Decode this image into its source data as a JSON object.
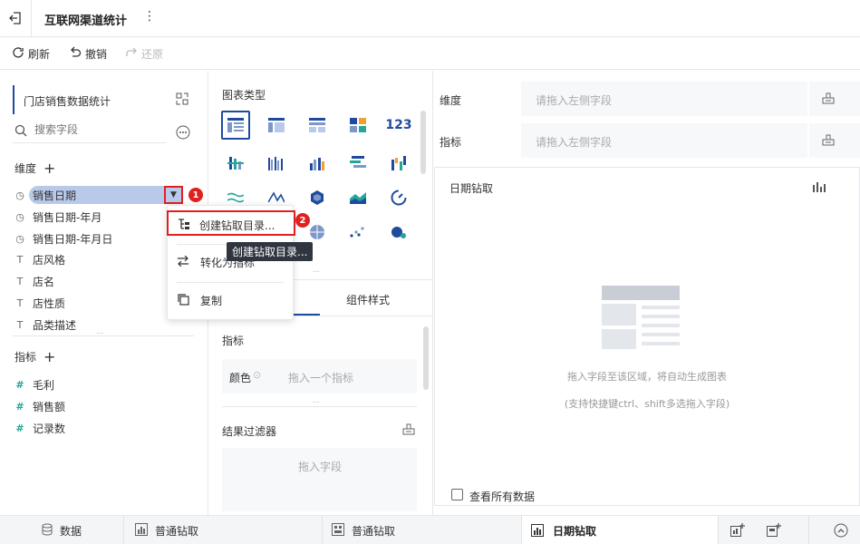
{
  "app": {
    "title": "互联网渠道统计"
  },
  "toolbar": {
    "refresh": "刷新",
    "undo": "撤销",
    "redo": "还原"
  },
  "dataset": {
    "name": "门店销售数据统计"
  },
  "search": {
    "placeholder": "搜索字段"
  },
  "dimensions": {
    "title": "维度",
    "items": [
      "销售日期",
      "销售日期-年月",
      "销售日期-年月日",
      "店风格",
      "店名",
      "店性质",
      "品类描述"
    ]
  },
  "measures": {
    "title": "指标",
    "items": [
      "毛利",
      "销售额",
      "记录数"
    ]
  },
  "context_menu": {
    "items": [
      "创建钻取目录...",
      "转化为指标",
      "复制"
    ],
    "tooltip": "创建钻取目录...",
    "badge1": "1",
    "badge2": "2"
  },
  "chart_panel": {
    "title": "图表类型",
    "tab_style": "组件样式",
    "metric_label": "指标",
    "color_label": "颜色",
    "color_placeholder": "拖入一个指标",
    "filter_title": "结果过滤器",
    "filter_placeholder": "拖入字段"
  },
  "axes": {
    "dim_label": "维度",
    "dim_placeholder": "请拖入左侧字段",
    "metric_label": "指标",
    "metric_placeholder": "请拖入左侧字段"
  },
  "canvas": {
    "title": "日期钻取",
    "hint1": "拖入字段至该区域，将自动生成图表",
    "hint2": "(支持快捷键ctrl、shift多选拖入字段)",
    "view_all": "查看所有数据"
  },
  "bottom_tabs": {
    "data": "数据",
    "tab1": "普通钻取",
    "tab2": "普通钻取",
    "tab3": "日期钻取"
  },
  "colors": {
    "accent": "#1f4b9f",
    "highlight": "#b9c9ea",
    "red": "#e02020",
    "teal": "#26a59a"
  }
}
